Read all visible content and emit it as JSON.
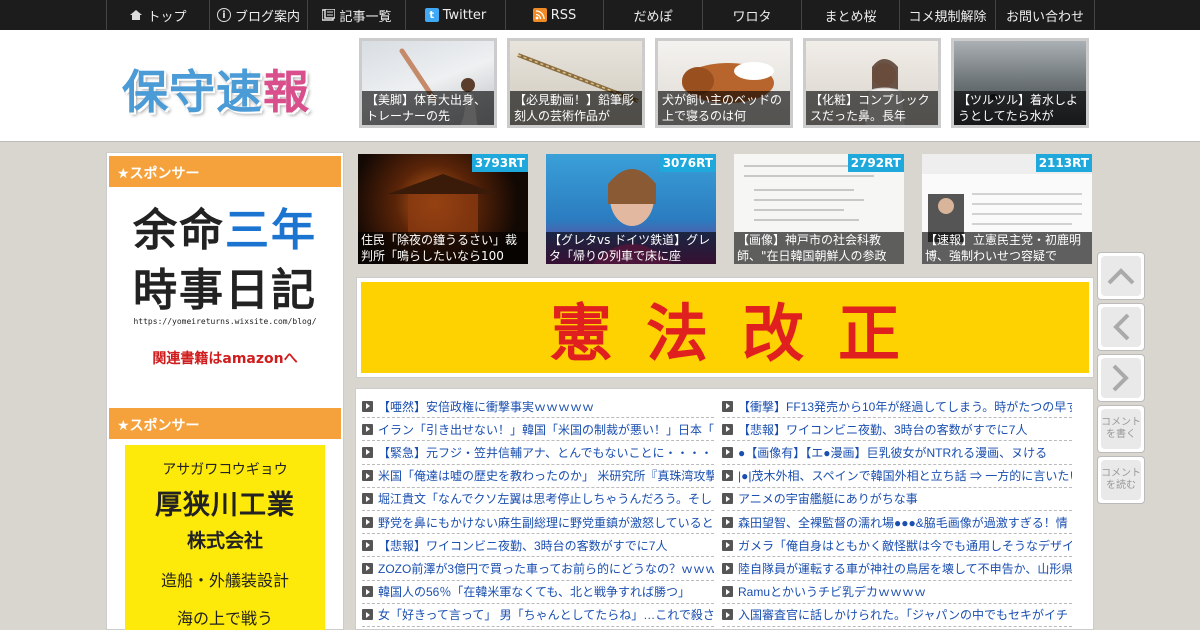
{
  "nav": [
    {
      "label": "トップ",
      "icon": "home-icon",
      "width": 104
    },
    {
      "label": "ブログ案内",
      "icon": "info-icon",
      "width": 98
    },
    {
      "label": "記事一覧",
      "icon": "list-icon",
      "width": 98
    },
    {
      "label": "Twitter",
      "icon": "twitter-icon",
      "width": 100
    },
    {
      "label": "RSS",
      "icon": "rss-icon",
      "width": 98
    },
    {
      "label": "だめぽ",
      "icon": "",
      "width": 99
    },
    {
      "label": "ワロタ",
      "icon": "",
      "width": 99
    },
    {
      "label": "まとめ桜",
      "icon": "",
      "width": 98
    },
    {
      "label": "コメ規制解除",
      "icon": "",
      "width": 96
    },
    {
      "label": "お問い合わせ",
      "icon": "",
      "width": 99
    }
  ],
  "header": {
    "logo_text_main": "保守速",
    "logo_text_accent": "報",
    "thumbs": [
      {
        "caption": "【美脚】体育大出身、トレーナーの先"
      },
      {
        "caption": "【必見動画！】鉛筆彫刻人の芸術作品が"
      },
      {
        "caption": "犬が飼い主のベッドの上で寝るのは何"
      },
      {
        "caption": "【化粧】コンプレックスだった鼻。長年"
      },
      {
        "caption": "【ツルツル】着水しようとしてたら水が"
      }
    ]
  },
  "sidebar": {
    "sponsor_label_1": "★スポンサー",
    "sponsor_label_2": "★スポンサー",
    "ad1": {
      "line1_a": "余命",
      "line1_b": "三年",
      "line2": "時事日記",
      "url": "https://yomeireturns.wixsite.com/blog/",
      "link": "関連書籍はamazonへ"
    },
    "ad2": {
      "kana": "アサガワコウギョウ",
      "name": "厚狭川工業",
      "corp": "株式会社",
      "desc": "造船・外艤装設計",
      "cut": "海の上で戦う"
    }
  },
  "ranking": [
    {
      "rt": "3793RT",
      "caption": "住民「除夜の鐘うるさい」裁判所「鳴らしたいなら100"
    },
    {
      "rt": "3076RT",
      "caption": "【グレタvs ドイツ鉄道】グレタ「帰りの列車で床に座"
    },
    {
      "rt": "2792RT",
      "caption": "【画像】神戸市の社会科教師、\"在日韓国朝鮮人の参政"
    },
    {
      "rt": "2113RT",
      "caption": "【速報】立憲民主党・初鹿明博、強制わいせつ容疑で"
    }
  ],
  "banner": {
    "text": "憲法改正"
  },
  "news_left": [
    "【唖然】安倍政権に衝撃事実ｗｗｗｗｗ",
    "イラン「引き出せない！」韓国「米国の制裁が悪い！」日本「",
    "【緊急】元フジ・笠井信輔アナ、とんでもないことに・・・・",
    "米国「俺達は嘘の歴史を教わったのか」 米研究所『真珠湾攻撃",
    "堀江貴文「なんでクソ左翼は思考停止しちゃうんだろう。そし",
    "野党を鼻にもかけない麻生副総理に野党重鎮が激怒しているとか",
    "【悲報】ワイコンビニ夜勤、3時台の客数がすでに7人",
    "ZOZO前澤が3億円で買った車ってお前ら的にどうなの？ｗｗｗ",
    "韓国人の56％「在韓米軍なくても、北と戦争すれば勝つ」",
    "女「好きって言って」 男「ちゃんとしてたらね」…これで殺さ"
  ],
  "news_right": [
    "【衝撃】FF13発売から10年が経過してしまう。時がたつの早す",
    "【悲報】ワイコンビニ夜勤、3時台の客数がすでに7人",
    "●【画像有】【エ●漫画】巨乳彼女がNTRれる漫画、ヌける",
    "|●|茂木外相、スペインで韓国外相と立ち話 ⇒ 一方的に言いたい",
    "アニメの宇宙艦艇にありがちな事",
    "森田望智、全裸監督の濡れ場●●●&脇毛画像が過激すぎる！情",
    "ガメラ「俺自身はともかく敵怪獣は今でも通用しそうなデザイ",
    "陸自隊員が運転する車が神社の鳥居を壊して不申告か、山形県",
    "Ramuとかいうチビ乳デカｗｗｗｗ",
    "入国審査官に話しかけられた。「ジャパンの中でもセキがイチ"
  ],
  "side_buttons": {
    "top": "page-top",
    "prev": "prev-article",
    "next": "next-article",
    "write": "コメントを書く",
    "read": "コメントを読む"
  }
}
